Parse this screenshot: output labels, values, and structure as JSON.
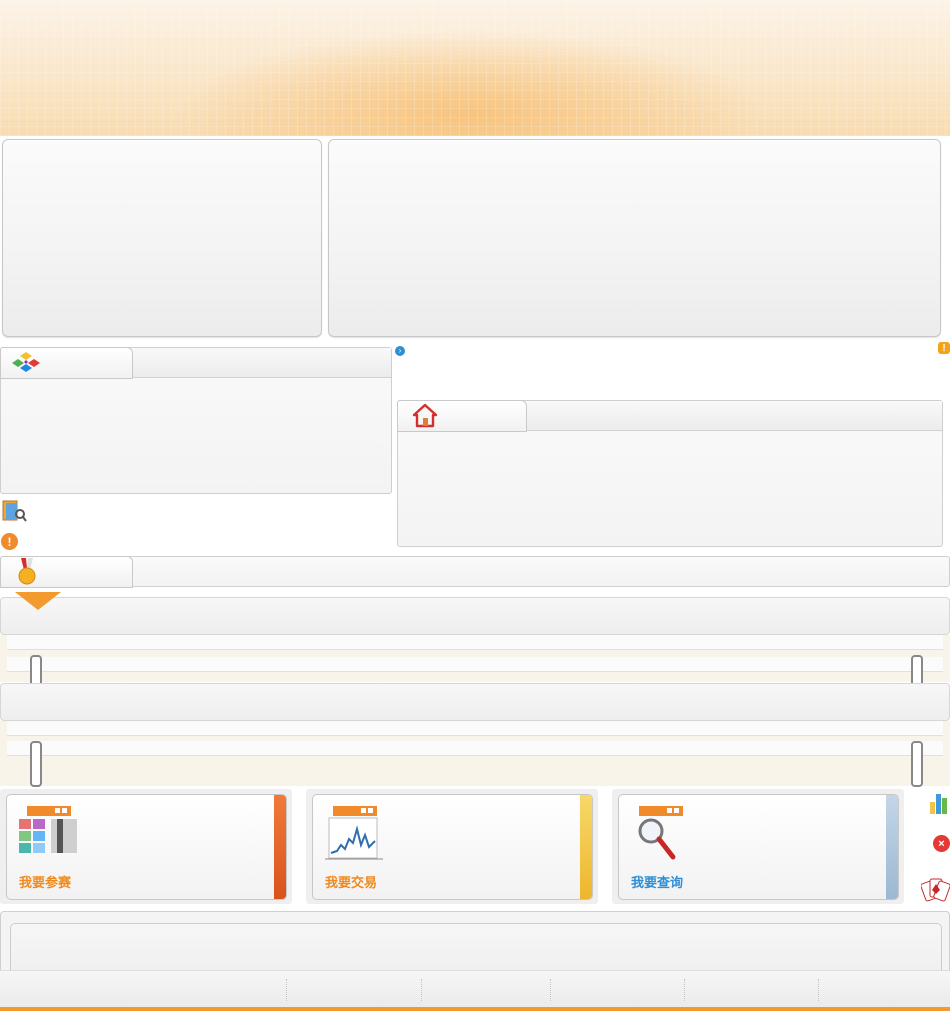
{
  "actions": {
    "join": {
      "label": "我要参赛",
      "icon": "data-grid-icon"
    },
    "trade": {
      "label": "我要交易",
      "icon": "line-chart-window-icon"
    },
    "query": {
      "label": "我要查询",
      "icon": "magnifier-window-icon"
    }
  },
  "colors": {
    "accent_orange": "#f39a2e",
    "stripe_join": "#e5642a",
    "stripe_trade": "#f3c34a",
    "stripe_query": "#a7c0d8",
    "label_orange": "#f08a1e"
  },
  "icons": {
    "section_a": "colorful-cubes-icon",
    "section_b": "house-icon",
    "section_c": "medal-icon",
    "info_arrow": "circle-arrow-icon",
    "notice": "exclamation-badge-icon",
    "book_tool": "book-magnifier-icon",
    "warning": "warning-icon",
    "side_chart": "bar-chart-icon",
    "side_close": "close-circle-icon",
    "side_cards": "playing-cards-icon"
  }
}
